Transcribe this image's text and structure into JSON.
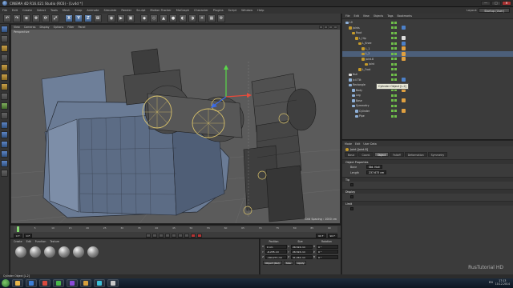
{
  "window": {
    "title": "CINEMA 4D R16.021 Studio (RC6) - [Lv4d *]",
    "controls": [
      "—",
      "□",
      "✕"
    ]
  },
  "menu": [
    "File",
    "Edit",
    "Create",
    "Select",
    "Tools",
    "Mesh",
    "Snap",
    "Animate",
    "Simulate",
    "Render",
    "Sculpt",
    "Motion Tracker",
    "MoGraph",
    "Character",
    "Plugins",
    "Script",
    "Window",
    "Help"
  ],
  "layout": {
    "label": "Layout:",
    "value": "Startup (User)"
  },
  "toolbar": {
    "buttons": [
      "↶",
      "↷",
      "⊕",
      "✥",
      "⟳",
      "⤢",
      "",
      "X",
      "Y",
      "Z",
      "⊞",
      "",
      "◉",
      "▶",
      "▣",
      "",
      "◆",
      "◇",
      "▲",
      "●",
      "◐",
      "◑",
      "☀",
      "▦",
      "⚙"
    ]
  },
  "viewport": {
    "menu": [
      "View",
      "Cameras",
      "Display",
      "Options",
      "Filter",
      "Panel"
    ],
    "label": "Perspective",
    "grid_spacing": "Grid Spacing : 1000 cm"
  },
  "object_manager": {
    "menu": [
      "File",
      "Edit",
      "View",
      "Objects",
      "Tags",
      "Bookmarks"
    ],
    "rows": [
      {
        "name": "L0",
        "indent": 0,
        "color": "#8fb0d8",
        "tag": ""
      },
      {
        "name": "Joints",
        "indent": 1,
        "color": "#c59a2a",
        "tag": "#4c80c8"
      },
      {
        "name": "Root",
        "indent": 2,
        "color": "#c59a2a",
        "tag": ""
      },
      {
        "name": "L_Hip",
        "indent": 3,
        "color": "#c59a2a",
        "tag": "#ddd"
      },
      {
        "name": "L_Knee",
        "indent": 4,
        "color": "#c59a2a",
        "tag": "#4c80c8"
      },
      {
        "name": "L_1",
        "indent": 5,
        "color": "#c59a2a",
        "tag": "#e0a040"
      },
      {
        "name": "L_2",
        "indent": 5,
        "color": "#c59a2a",
        "tag": "#e0a040"
      },
      {
        "name": "Joint.8",
        "indent": 5,
        "color": "#c59a2a",
        "tag": "#e0a040"
      },
      {
        "name": "Joint",
        "indent": 6,
        "color": "#c59a2a",
        "tag": ""
      },
      {
        "name": "L_Foot",
        "indent": 4,
        "color": "#c59a2a",
        "tag": ""
      },
      {
        "name": "Null",
        "indent": 1,
        "color": "#dddddd",
        "tag": ""
      },
      {
        "name": "Jc4 Tilt",
        "indent": 1,
        "color": "#8fb0d8",
        "tag": "#4c80c8"
      },
      {
        "name": "Rectangle",
        "indent": 1,
        "color": "#8fb0d8",
        "tag": ""
      },
      {
        "name": "Body",
        "indent": 2,
        "color": "#8fb0d8",
        "tag": "#e0a040"
      },
      {
        "name": "Leg",
        "indent": 2,
        "color": "#8fb0d8",
        "tag": ""
      },
      {
        "name": "Base",
        "indent": 2,
        "color": "#8fb0d8",
        "tag": "#e0a040"
      },
      {
        "name": "Symmetry",
        "indent": 2,
        "color": "#8fb0d8",
        "tag": ""
      },
      {
        "name": "Cylinder",
        "indent": 3,
        "color": "#8fb0d8",
        "tag": "#e0a040"
      },
      {
        "name": "Pipe",
        "indent": 3,
        "color": "#8fb0d8",
        "tag": ""
      }
    ],
    "tooltip": "Cylinder Object [L.2]"
  },
  "attribute_manager": {
    "menu": [
      "Mode",
      "Edit",
      "User Data"
    ],
    "object_name": "Joint [Joint.8]",
    "tabs": [
      "Basic",
      "Coord.",
      "Object",
      "Falloff",
      "Deformation",
      "Symmetry"
    ],
    "active_tab": "Object",
    "section": "Object Properties",
    "fields": [
      {
        "label": "Bone",
        "value": "Std. Null"
      },
      {
        "label": "Length",
        "value": "237.673 cm"
      }
    ],
    "subsections": [
      "Tip",
      "Display",
      "Limit"
    ]
  },
  "timeline": {
    "ticks": [
      "0",
      "5",
      "10",
      "15",
      "20",
      "25",
      "30",
      "35",
      "40",
      "45",
      "50",
      "55",
      "60",
      "65",
      "70",
      "75",
      "80",
      "85",
      "90"
    ],
    "start": "0 F",
    "current": "0 F",
    "end": "90 F",
    "max": "90 F",
    "playhead_fraction": 0.0
  },
  "materials": {
    "menu": [
      "Create",
      "Edit",
      "Function",
      "Texture"
    ],
    "count": 6
  },
  "coordinates": {
    "headers": [
      "Position",
      "Size",
      "Rotation"
    ],
    "rows": [
      {
        "axis": "X",
        "pos": "0 cm",
        "size": "26.524 cm",
        "rot_axis": "H",
        "rot": "0 °"
      },
      {
        "axis": "Y",
        "pos": "-6.235 cm",
        "size": "26.524 cm",
        "rot_axis": "P",
        "rot": "0 °"
      },
      {
        "axis": "Z",
        "pos": "-194.271 cm",
        "size": "41.261 cm",
        "rot_axis": "B",
        "rot": "0 °"
      }
    ],
    "mode": "Object (Rel)",
    "size_mode": "Size",
    "apply": "Apply"
  },
  "status": "Cylinder Object [L.2]",
  "watermark": "RusTutorial HD",
  "taskbar": {
    "apps": [
      "#e8b64a",
      "#3d7fd8",
      "#d84a3d",
      "#4ab84a",
      "#8a4ad8",
      "#d8a03d",
      "#3dc0d8",
      "#c8c8c8"
    ],
    "lang": "EN",
    "time": "17:13",
    "date": "10.12.2014"
  },
  "colors": {
    "accent": "#6c8fbd",
    "viewport_bg": "#5a5a5a",
    "selection": "#4c5f7a"
  }
}
